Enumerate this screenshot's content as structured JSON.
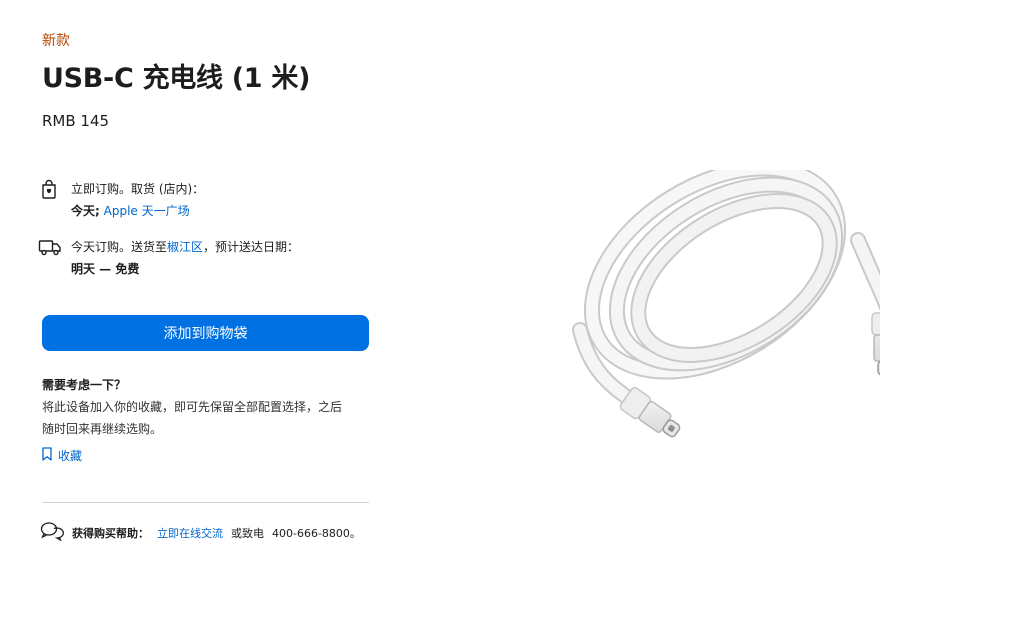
{
  "product": {
    "badge": "新款",
    "title": "USB-C 充电线 (1 米)",
    "price": "RMB 145"
  },
  "pickup": {
    "line1": "立即订购。取货 (店内)：",
    "date": "今天;",
    "store": "Apple 天一广场"
  },
  "delivery": {
    "line1_prefix": "今天订购。送货至",
    "location": "椒江区",
    "line1_suffix": "，预计送达日期：",
    "date": "明天 — 免费"
  },
  "add_to_bag_label": "添加到购物袋",
  "consider": {
    "heading": "需要考虑一下？",
    "body": "将此设备加入你的收藏，即可先保留全部配置选择，之后随时回来再继续选购。",
    "save_label": "收藏"
  },
  "help": {
    "label": "获得购买帮助：",
    "chat_link": "立即在线交流",
    "or_call": "或致电",
    "phone": "400-666-8800。"
  },
  "image": {
    "alt": "icon: usb-c-cable-image"
  },
  "colors": {
    "accent": "#0071e3",
    "link": "#0066cc",
    "badge": "#b64400"
  }
}
